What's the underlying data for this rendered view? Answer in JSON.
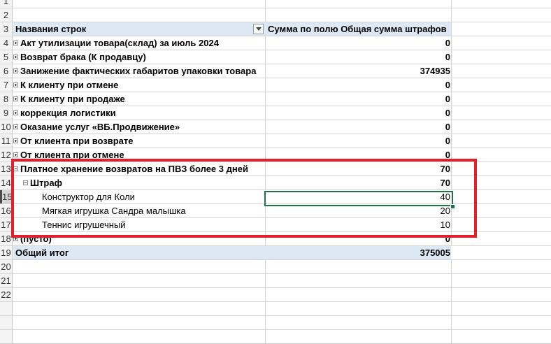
{
  "header": {
    "col_a": "Названия строк",
    "col_b": "Сумма по полю Общая сумма штрафов"
  },
  "groups": [
    {
      "label": "Акт утилизации товара(склад) за июль 2024",
      "value": "0"
    },
    {
      "label": "Возврат брака (К продавцу)",
      "value": "0"
    },
    {
      "label": "Занижение фактических габаритов упаковки товара",
      "value": "374935"
    },
    {
      "label": "К клиенту при отмене",
      "value": "0"
    },
    {
      "label": "К клиенту при продаже",
      "value": "0"
    },
    {
      "label": "коррекция логистики",
      "value": "0"
    },
    {
      "label": "Оказание услуг «ВБ.Продвижение»",
      "value": "0"
    },
    {
      "label": "От клиента при возврате",
      "value": "0"
    },
    {
      "label": "От клиента при отмене",
      "value": "0"
    },
    {
      "label": "Платное хранение возвратов на ПВЗ более 3 дней",
      "value": "70"
    }
  ],
  "subgroup": {
    "label": "Штраф",
    "value": "70"
  },
  "details": [
    {
      "label": "Конструктор для Коли",
      "value": "40"
    },
    {
      "label": "Мягкая игрушка Сандра малышка",
      "value": "20"
    },
    {
      "label": "Теннис игрушечный",
      "value": "10"
    }
  ],
  "empty_group": {
    "label": "(пусто)",
    "value": "0"
  },
  "total": {
    "label": "Общий итог",
    "value": "375005"
  },
  "row_numbers": [
    "1",
    "2",
    "3",
    "4",
    "5",
    "6",
    "7",
    "8",
    "9",
    "10",
    "11",
    "12",
    "13",
    "14",
    "15",
    "16",
    "17",
    "18",
    "19",
    "20",
    "21",
    "22"
  ],
  "colors": {
    "accent_green": "#217346",
    "highlight_red": "#e0202c",
    "header_fill": "#dde8f5"
  }
}
